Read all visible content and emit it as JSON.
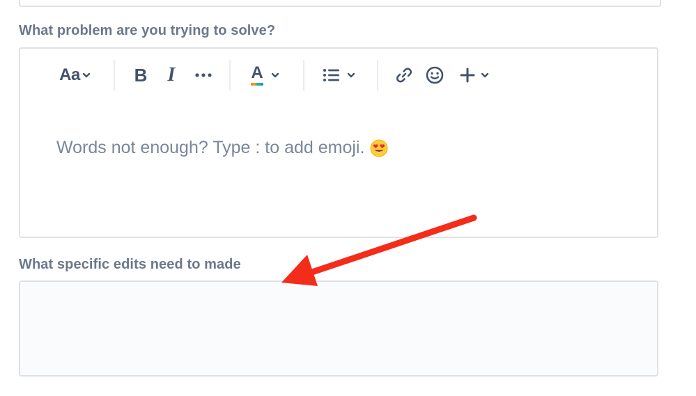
{
  "form": {
    "question_1_label": "What problem are you trying to solve?",
    "question_2_label": "What specific edits need to made",
    "editor_placeholder": "Words not enough? Type : to add emoji.",
    "editor_placeholder_emoji": "heart-eyes-emoji"
  },
  "toolbar": {
    "text_style_label": "Aa",
    "bold_label": "B",
    "italic_label": "I",
    "more_label": "•••",
    "text_color_label": "A",
    "icons": [
      "chevron-down-icon",
      "bullet-list-icon",
      "link-icon",
      "emoji-icon",
      "plus-icon"
    ]
  },
  "annotation": {
    "arrow_color": "#f42c1a"
  },
  "colors": {
    "border": "#dfe1e6",
    "label_text": "#6b778c",
    "toolbar_icon": "#42526e",
    "placeholder_text": "#7a869a",
    "textarea_bg": "#fafbfc"
  }
}
